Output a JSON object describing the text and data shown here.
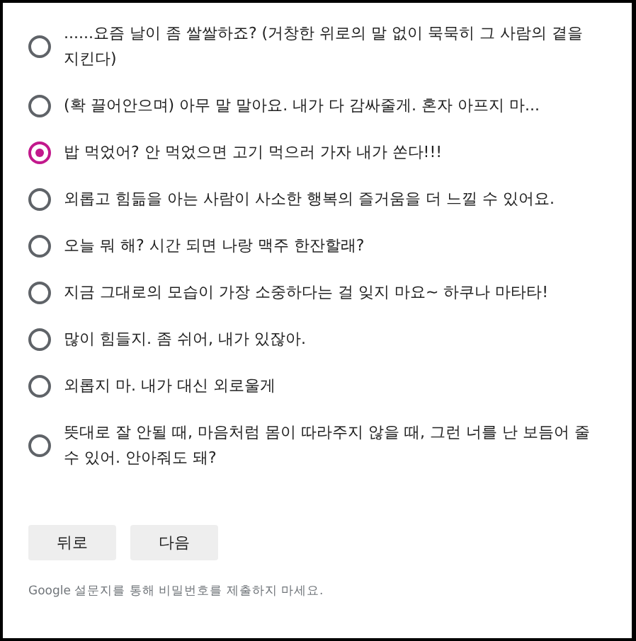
{
  "options": [
    {
      "label": "......요즘 날이 좀 쌀쌀하죠? (거창한 위로의 말 없이 묵묵히 그 사람의 곁을 지킨다)",
      "selected": false
    },
    {
      "label": "(확 끌어안으며) 아무 말 말아요. 내가 다 감싸줄게. 혼자 아프지 마...",
      "selected": false
    },
    {
      "label": "밥 먹었어? 안 먹었으면 고기 먹으러 가자 내가 쏜다!!!",
      "selected": true
    },
    {
      "label": "외롭고 힘듦을 아는 사람이 사소한 행복의 즐거움을 더 느낄 수 있어요.",
      "selected": false
    },
    {
      "label": "오늘 뭐 해? 시간 되면 나랑 맥주 한잔할래?",
      "selected": false
    },
    {
      "label": "지금 그대로의 모습이 가장 소중하다는 걸 잊지 마요~ 하쿠나 마타타!",
      "selected": false
    },
    {
      "label": "많이 힘들지. 좀 쉬어, 내가 있잖아.",
      "selected": false
    },
    {
      "label": "외롭지 마. 내가 대신 외로울게",
      "selected": false
    },
    {
      "label": "뜻대로 잘 안될 때, 마음처럼 몸이 따라주지 않을 때, 그런 너를 난 보듬어 줄 수 있어. 안아줘도 돼?",
      "selected": false
    }
  ],
  "buttons": [
    "뒤로",
    "다음"
  ],
  "footer": "Google 설문지를 통해 비밀번호를 제출하지 마세요."
}
